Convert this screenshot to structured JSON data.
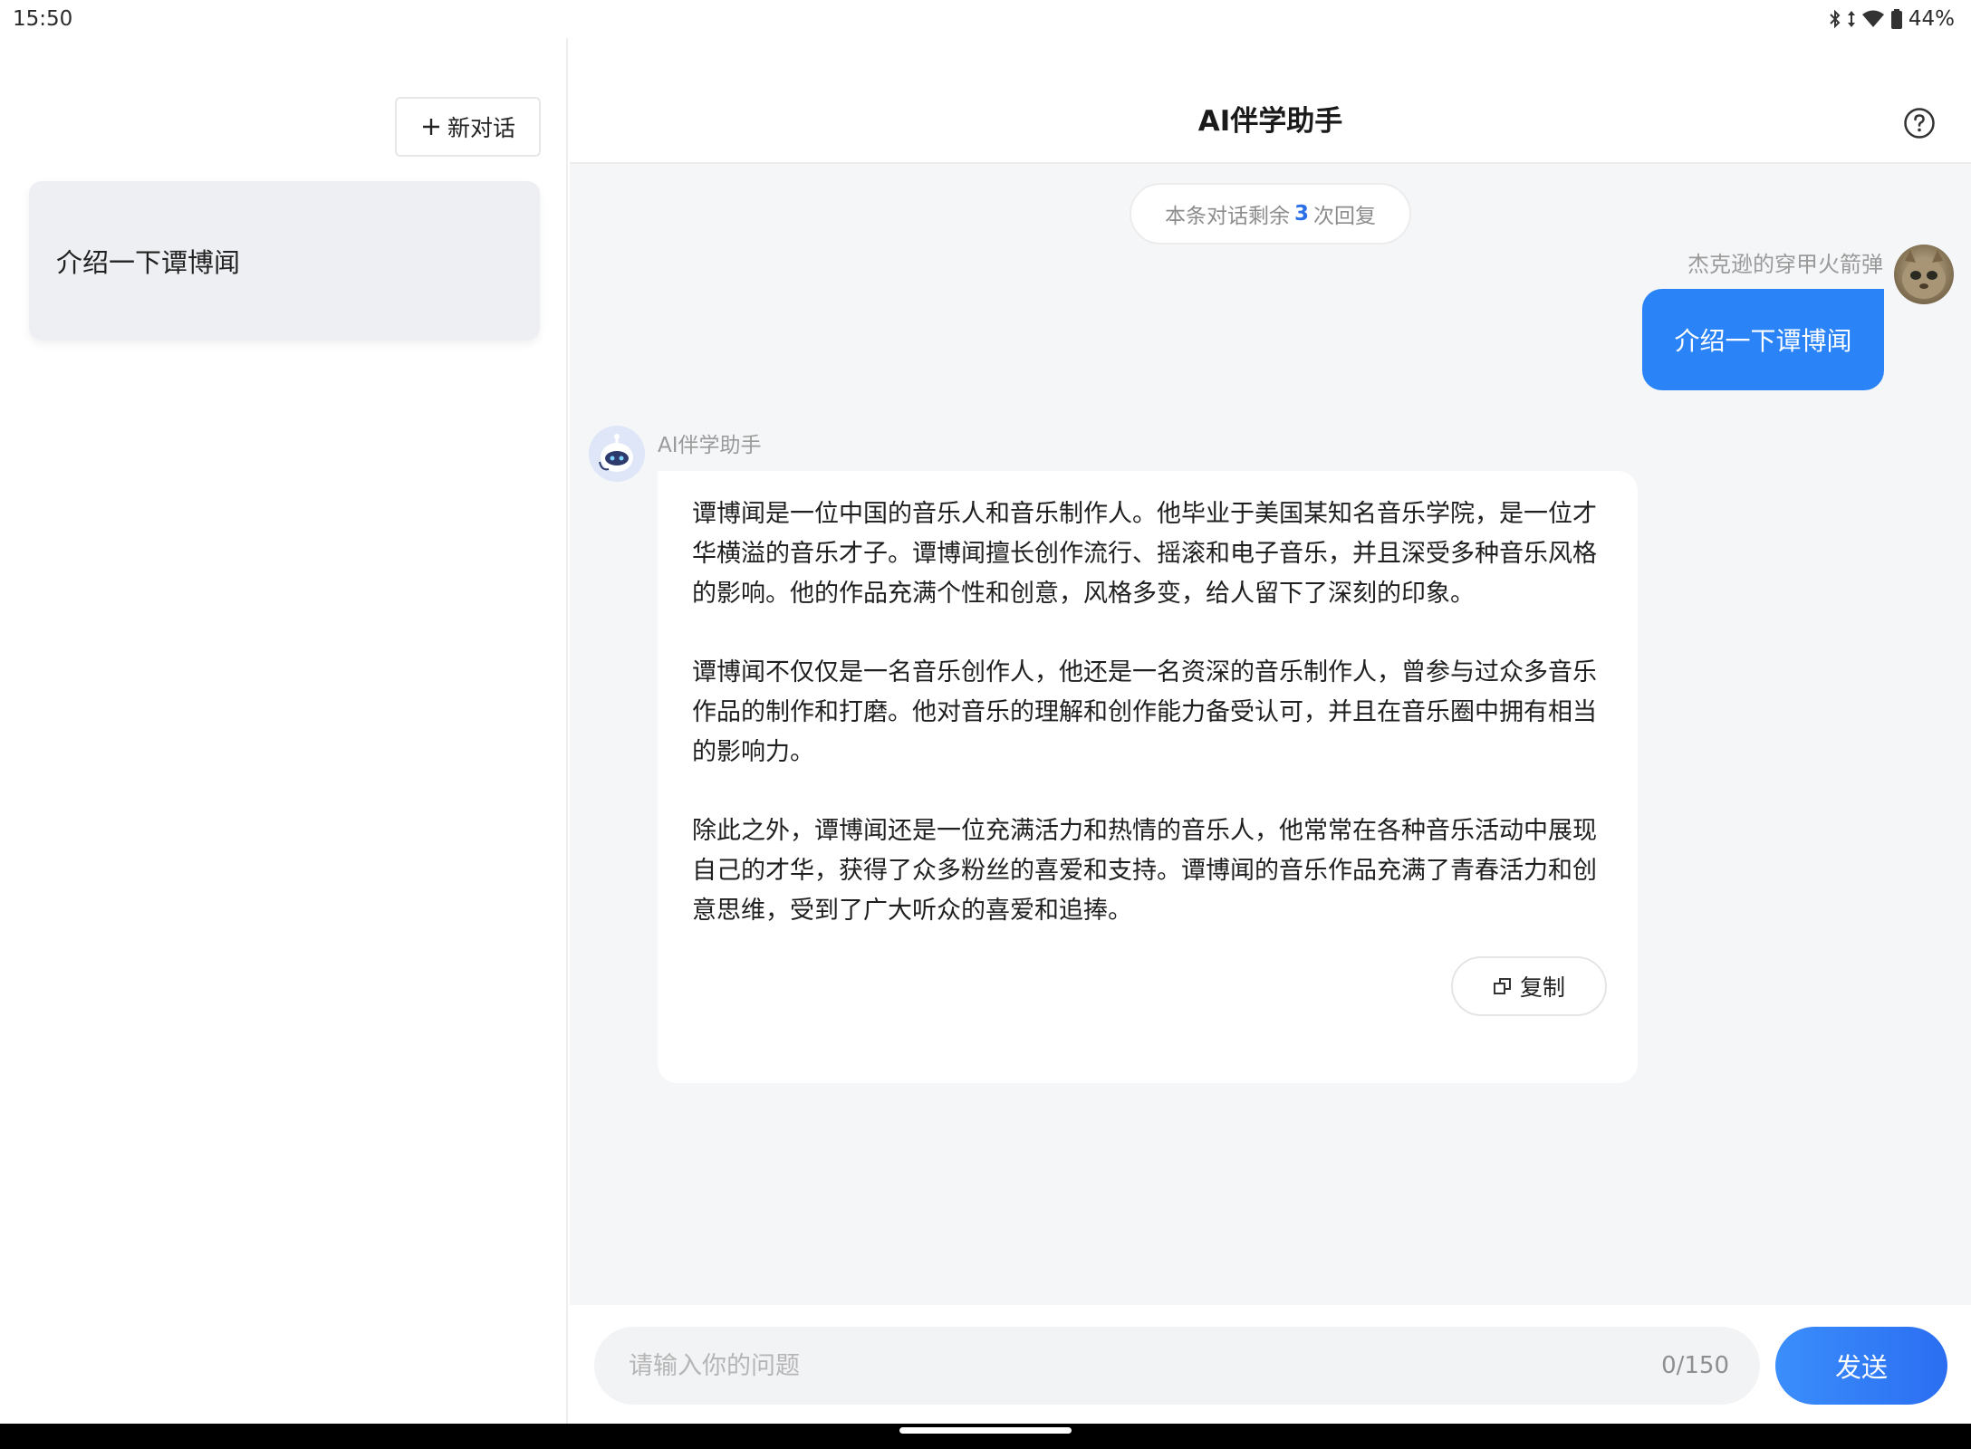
{
  "status_bar": {
    "time": "15:50",
    "battery": "44%",
    "icons": [
      "bluetooth-icon",
      "data-arrows-icon",
      "wifi-icon",
      "battery-icon"
    ]
  },
  "sidebar": {
    "new_chat_label": "新对话",
    "history": [
      {
        "title": "介绍一下谭博闻"
      }
    ]
  },
  "header": {
    "title": "AI伴学助手",
    "help_icon": "help-circle-icon"
  },
  "remaining": {
    "prefix": "本条对话剩余",
    "count": "3",
    "suffix": "次回复"
  },
  "user_message": {
    "name": "杰克逊的穿甲火箭弹",
    "text": "介绍一下谭博闻"
  },
  "bot_message": {
    "name": "AI伴学助手",
    "paragraphs": [
      "谭博闻是一位中国的音乐人和音乐制作人。他毕业于美国某知名音乐学院，是一位才华横溢的音乐才子。谭博闻擅长创作流行、摇滚和电子音乐，并且深受多种音乐风格的影响。他的作品充满个性和创意，风格多变，给人留下了深刻的印象。",
      "谭博闻不仅仅是一名音乐创作人，他还是一名资深的音乐制作人，曾参与过众多音乐作品的制作和打磨。他对音乐的理解和创作能力备受认可，并且在音乐圈中拥有相当的影响力。",
      "除此之外，谭博闻还是一位充满活力和热情的音乐人，他常常在各种音乐活动中展现自己的才华，获得了众多粉丝的喜爱和支持。谭博闻的音乐作品充满了青春活力和创意思维，受到了广大听众的喜爱和追捧。"
    ],
    "copy_label": "复制"
  },
  "input": {
    "placeholder": "请输入你的问题",
    "value": "",
    "counter": "0/150",
    "send_label": "发送"
  },
  "colors": {
    "accent": "#2a84f8",
    "send_button": "#2b6ef2",
    "page_bg": "#f5f6f8",
    "history_item_bg": "#eeeff2"
  }
}
